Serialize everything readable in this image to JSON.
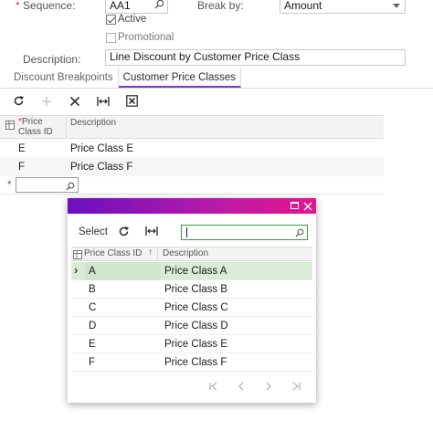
{
  "form": {
    "sequence_label": "Sequence:",
    "sequence_value": "AA1",
    "active_label": "Active",
    "active_checked": true,
    "promotional_label": "Promotional",
    "promotional_checked": false,
    "break_by_label": "Break by:",
    "break_by_value": "Amount",
    "description_label": "Description:",
    "description_value": "Line Discount by Customer Price Class"
  },
  "tabs": [
    {
      "label": "Discount Breakpoints",
      "active": false
    },
    {
      "label": "Customer Price Classes",
      "active": true
    }
  ],
  "grid": {
    "headers": {
      "price_class_id": "Price Class ID",
      "description": "Description"
    },
    "rows": [
      {
        "id": "E",
        "description": "Price Class E"
      },
      {
        "id": "F",
        "description": "Price Class F"
      }
    ],
    "new_row_marker": "*"
  },
  "dialog": {
    "select_label": "Select",
    "search_value": "",
    "headers": {
      "price_class_id": "Price Class ID",
      "description": "Description",
      "sort_indicator": "↑"
    },
    "rows": [
      {
        "id": "A",
        "description": "Price Class A",
        "selected": true
      },
      {
        "id": "B",
        "description": "Price Class B"
      },
      {
        "id": "C",
        "description": "Price Class C"
      },
      {
        "id": "D",
        "description": "Price Class D"
      },
      {
        "id": "E",
        "description": "Price Class E"
      },
      {
        "id": "F",
        "description": "Price Class F"
      }
    ],
    "current_row_marker": "›"
  },
  "colors": {
    "accent": "#7b3fbf",
    "title_gradient_start": "#6a0fbf",
    "title_gradient_end": "#e2168d",
    "selected_row": "#d9ecd5"
  }
}
